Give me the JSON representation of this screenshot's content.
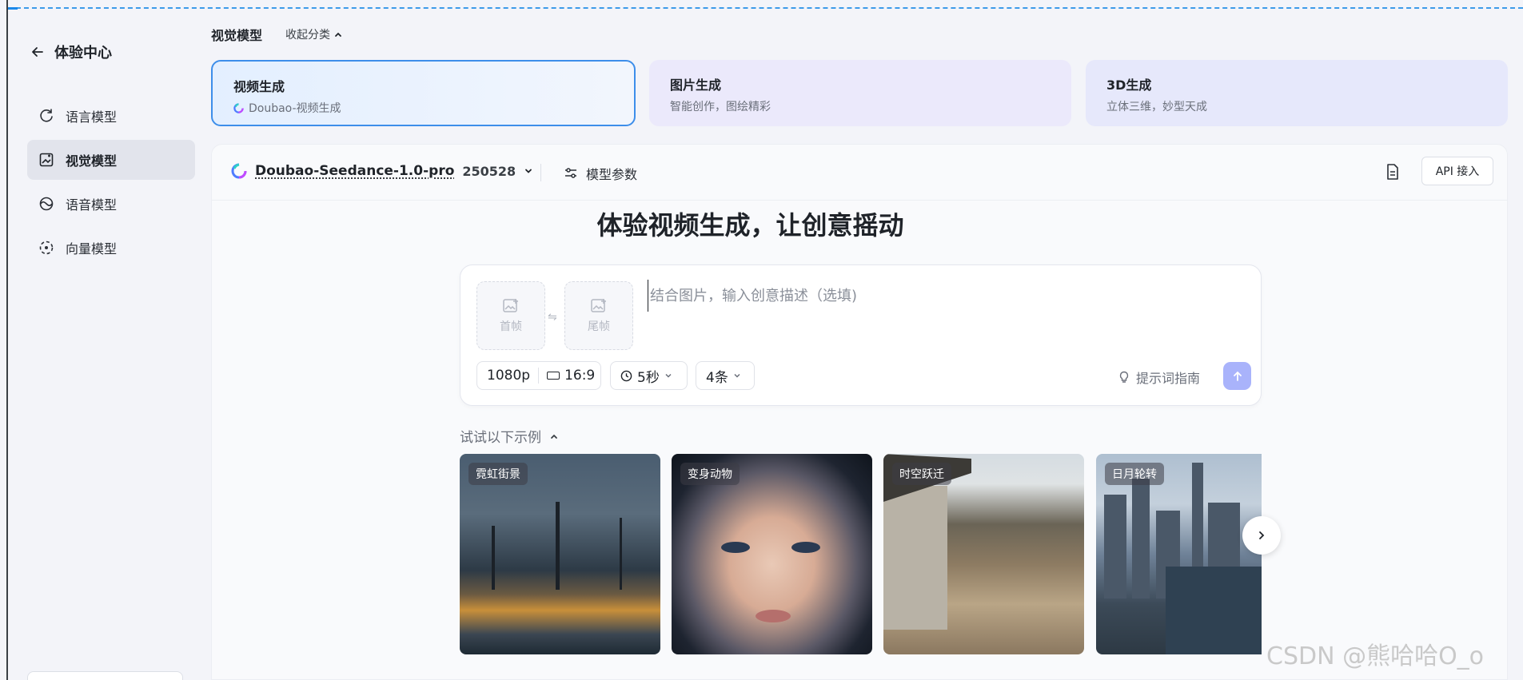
{
  "sidebar": {
    "back_label": "体验中心",
    "items": [
      {
        "label": "语言模型",
        "icon": "refresh-icon"
      },
      {
        "label": "视觉模型",
        "icon": "image-edit-icon",
        "active": true
      },
      {
        "label": "语音模型",
        "icon": "wave-icon"
      },
      {
        "label": "向量模型",
        "icon": "vector-icon"
      }
    ]
  },
  "header": {
    "title": "视觉模型",
    "collapse_label": "收起分类"
  },
  "cards": [
    {
      "title": "视频生成",
      "subtitle": "Doubao-视频生成"
    },
    {
      "title": "图片生成",
      "subtitle": "智能创作，图绘精彩"
    },
    {
      "title": "3D生成",
      "subtitle": "立体三维，妙型天成"
    }
  ],
  "toolbar": {
    "model_name": "Doubao-Seedance-1.0-pro",
    "model_version": "250528",
    "params_label": "模型参数",
    "api_label": "API 接入"
  },
  "main": {
    "headline": "体验视频生成，让创意摇动",
    "prompt_placeholder": "结合图片，输入创意描述（选填)",
    "first_frame": "首帧",
    "last_frame": "尾帧",
    "resolution": "1080p",
    "ratio": "16:9",
    "duration": "5秒",
    "count": "4条",
    "tips_label": "提示词指南",
    "examples_title": "试试以下示例",
    "examples": [
      "霓虹街景",
      "变身动物",
      "时空跃迁",
      "日月轮转"
    ]
  },
  "watermark": "CSDN @熊哈哈O_o",
  "colors": {
    "accent": "#3d8eea",
    "send_button": "#a9b3fb",
    "active_nav": "#e2e4ec"
  }
}
